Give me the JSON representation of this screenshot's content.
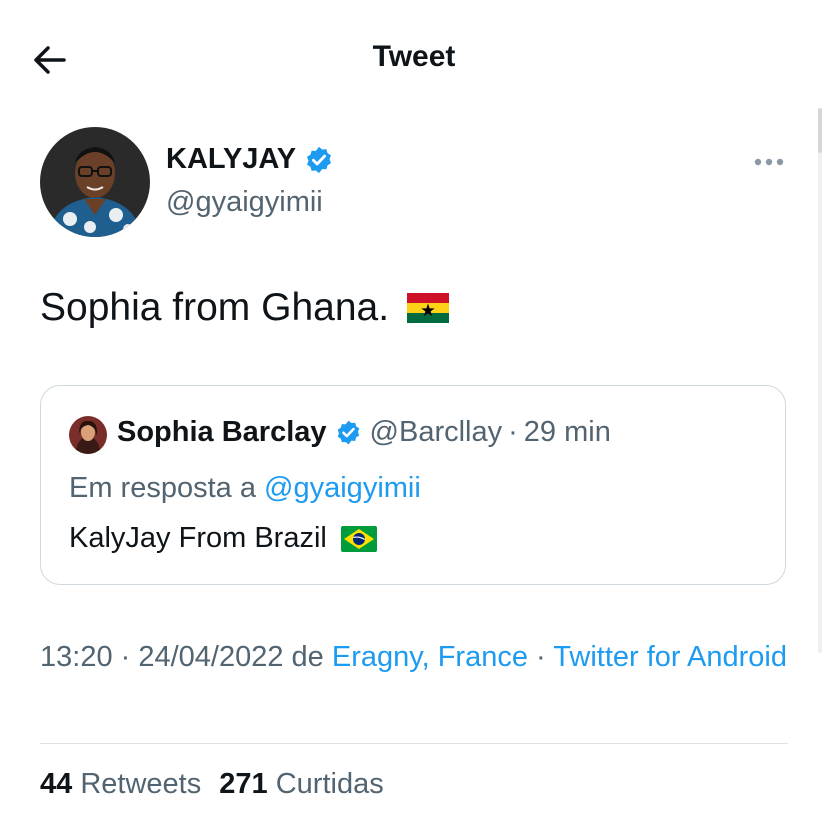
{
  "header": {
    "title": "Tweet",
    "back_icon": "arrow-left-icon"
  },
  "tweet": {
    "author": {
      "name": "KALYJAY",
      "handle": "@gyaigyimii",
      "verified": true
    },
    "text": "Sophia from Ghana.",
    "emoji": "flag-ghana",
    "quote": {
      "author": {
        "name": "Sophia Barclay",
        "handle": "@Barcllay",
        "time": "29 min",
        "verified": true
      },
      "reply_prefix": "Em resposta a",
      "reply_to": "@gyaigyimii",
      "text": "KalyJay From Brazil",
      "emoji": "flag-brazil"
    },
    "timestamp": "13:20 · 24/04/2022",
    "location_prefix": "de",
    "location": "Eragny, France",
    "separator": "·",
    "source": "Twitter for Android",
    "stats": {
      "retweets_count": "44",
      "retweets_label": "Retweets",
      "likes_count": "271",
      "likes_label": "Curtidas"
    }
  },
  "colors": {
    "link": "#1d9bf0",
    "verified": "#1d9bf0",
    "muted": "#536471",
    "text": "#0f1419"
  }
}
